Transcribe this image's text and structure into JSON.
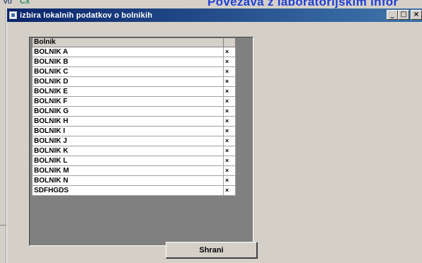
{
  "background": {
    "left_text": "Vo",
    "left_text2": "Cx",
    "title_text": "Povezava z laboratorijskim infor"
  },
  "window": {
    "title": "izbira lokalnih podatkov o bolnikih",
    "controls": {
      "minimize": "_",
      "maximize": "□",
      "close": "×"
    }
  },
  "grid": {
    "header": [
      "Bolnik",
      ""
    ],
    "rows": [
      {
        "name": "BOLNIK A",
        "action": "×"
      },
      {
        "name": "BOLNIK B",
        "action": "×"
      },
      {
        "name": "BOLNIK C",
        "action": "×"
      },
      {
        "name": "BOLNIK D",
        "action": "×"
      },
      {
        "name": "BOLNIK E",
        "action": "×"
      },
      {
        "name": "BOLNIK F",
        "action": "×"
      },
      {
        "name": "BOLNIK G",
        "action": "×"
      },
      {
        "name": "BOLNIK H",
        "action": "×"
      },
      {
        "name": "BOLNIK I",
        "action": "×"
      },
      {
        "name": "BOLNIK J",
        "action": "×"
      },
      {
        "name": "BOLNIK K",
        "action": "×"
      },
      {
        "name": "BOLNIK L",
        "action": "×"
      },
      {
        "name": "BOLNIK M",
        "action": "×"
      },
      {
        "name": "BOLNIK N",
        "action": "×"
      },
      {
        "name": "SDFHGDS",
        "action": "×"
      }
    ]
  },
  "buttons": {
    "save_label": "Shrani"
  },
  "colors": {
    "titlebar_start": "#0a246a",
    "titlebar_end": "#3a6ea5",
    "face": "#d4d0c8",
    "grid_bg": "#808080",
    "bg_title": "#1f3fd6"
  }
}
